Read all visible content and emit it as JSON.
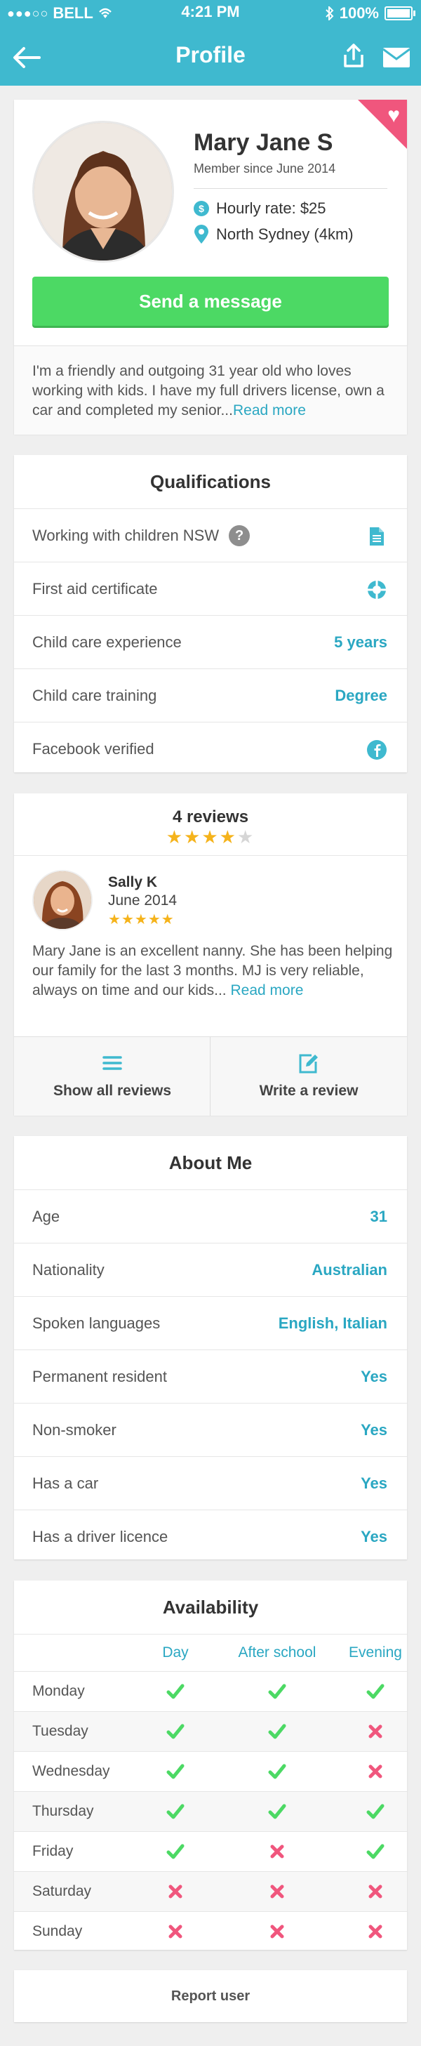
{
  "status_bar": {
    "carrier": "BELL",
    "time": "4:21 PM",
    "battery": "100%"
  },
  "header": {
    "title": "Profile"
  },
  "profile": {
    "name": "Mary Jane S",
    "member_since": "Member since June 2014",
    "hourly_rate": "Hourly rate: $25",
    "location": "North Sydney (4km)",
    "send_message_label": "Send a message",
    "bio": "I'm a friendly and outgoing 31 year old who loves working with kids. I have my full drivers license, own a car and completed my senior...",
    "read_more": "Read more"
  },
  "qualifications": {
    "title": "Qualifications",
    "items": [
      {
        "label": "Working with children NSW",
        "icon": "document-icon"
      },
      {
        "label": "First aid certificate",
        "icon": "lifebuoy-icon"
      },
      {
        "label": "Child care experience",
        "value": "5 years"
      },
      {
        "label": "Child care training",
        "value": "Degree"
      },
      {
        "label": "Facebook verified",
        "icon": "facebook-icon"
      }
    ]
  },
  "reviews": {
    "count_label": "4 reviews",
    "rating": 4,
    "max_rating": 5,
    "review": {
      "author": "Sally K",
      "date": "June 2014",
      "rating": 5,
      "text": "Mary Jane is an excellent nanny. She has been helping our family for the last 3 months. MJ is very reliable, always on time and our kids...",
      "read_more": "Read more"
    },
    "show_all_label": "Show all reviews",
    "write_label": "Write a review"
  },
  "about": {
    "title": "About Me",
    "items": [
      {
        "label": "Age",
        "value": "31"
      },
      {
        "label": "Nationality",
        "value": "Australian"
      },
      {
        "label": "Spoken languages",
        "value": "English, Italian"
      },
      {
        "label": "Permanent resident",
        "value": "Yes"
      },
      {
        "label": "Non-smoker",
        "value": "Yes"
      },
      {
        "label": "Has a car",
        "value": "Yes"
      },
      {
        "label": "Has a driver licence",
        "value": "Yes"
      }
    ]
  },
  "availability": {
    "title": "Availability",
    "columns": [
      "Day",
      "After school",
      "Evening"
    ],
    "rows": [
      {
        "day": "Monday",
        "slots": [
          true,
          true,
          true
        ]
      },
      {
        "day": "Tuesday",
        "slots": [
          true,
          true,
          false
        ]
      },
      {
        "day": "Wednesday",
        "slots": [
          true,
          true,
          false
        ]
      },
      {
        "day": "Thursday",
        "slots": [
          true,
          true,
          true
        ]
      },
      {
        "day": "Friday",
        "slots": [
          true,
          false,
          true
        ]
      },
      {
        "day": "Saturday",
        "slots": [
          false,
          false,
          false
        ]
      },
      {
        "day": "Sunday",
        "slots": [
          false,
          false,
          false
        ]
      }
    ]
  },
  "report_label": "Report user",
  "colors": {
    "accent": "#3fb9cf",
    "link": "#2aa7c2",
    "green": "#4cd964",
    "check": "#4cd964",
    "cross": "#f0567d",
    "star": "#f5b31b"
  }
}
